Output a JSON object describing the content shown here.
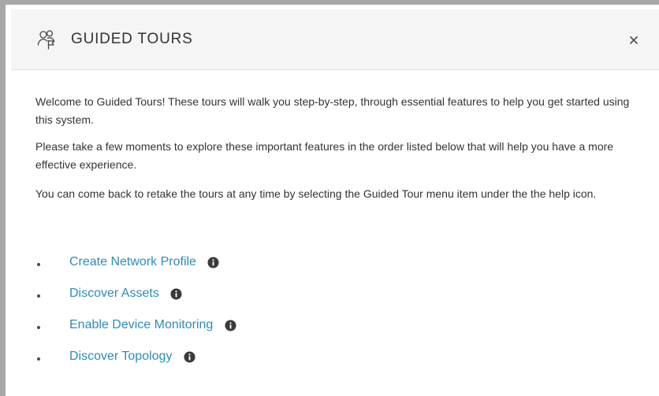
{
  "modal": {
    "title": "GUIDED TOURS",
    "header_icon": "users-flag-icon",
    "close_icon": "close-icon"
  },
  "body": {
    "paragraphs": [
      "Welcome to Guided Tours! These tours will walk you step-by-step, through essential features to help you get started using this system.",
      "Please take a few moments to explore these important features in the order listed below that will help you have a more effective experience.",
      "You can come back to retake the tours at any time by selecting the Guided Tour menu item under the the help icon."
    ]
  },
  "tours": [
    {
      "label": "Create Network Profile",
      "icon": "info-icon"
    },
    {
      "label": "Discover Assets",
      "icon": "info-icon"
    },
    {
      "label": "Enable Device Monitoring",
      "icon": "info-icon"
    },
    {
      "label": "Discover Topology",
      "icon": "info-icon"
    }
  ],
  "colors": {
    "link": "#2f8ab7",
    "text": "#333333",
    "header_background": "#f5f5f5",
    "frame": "#a7a7a7"
  }
}
